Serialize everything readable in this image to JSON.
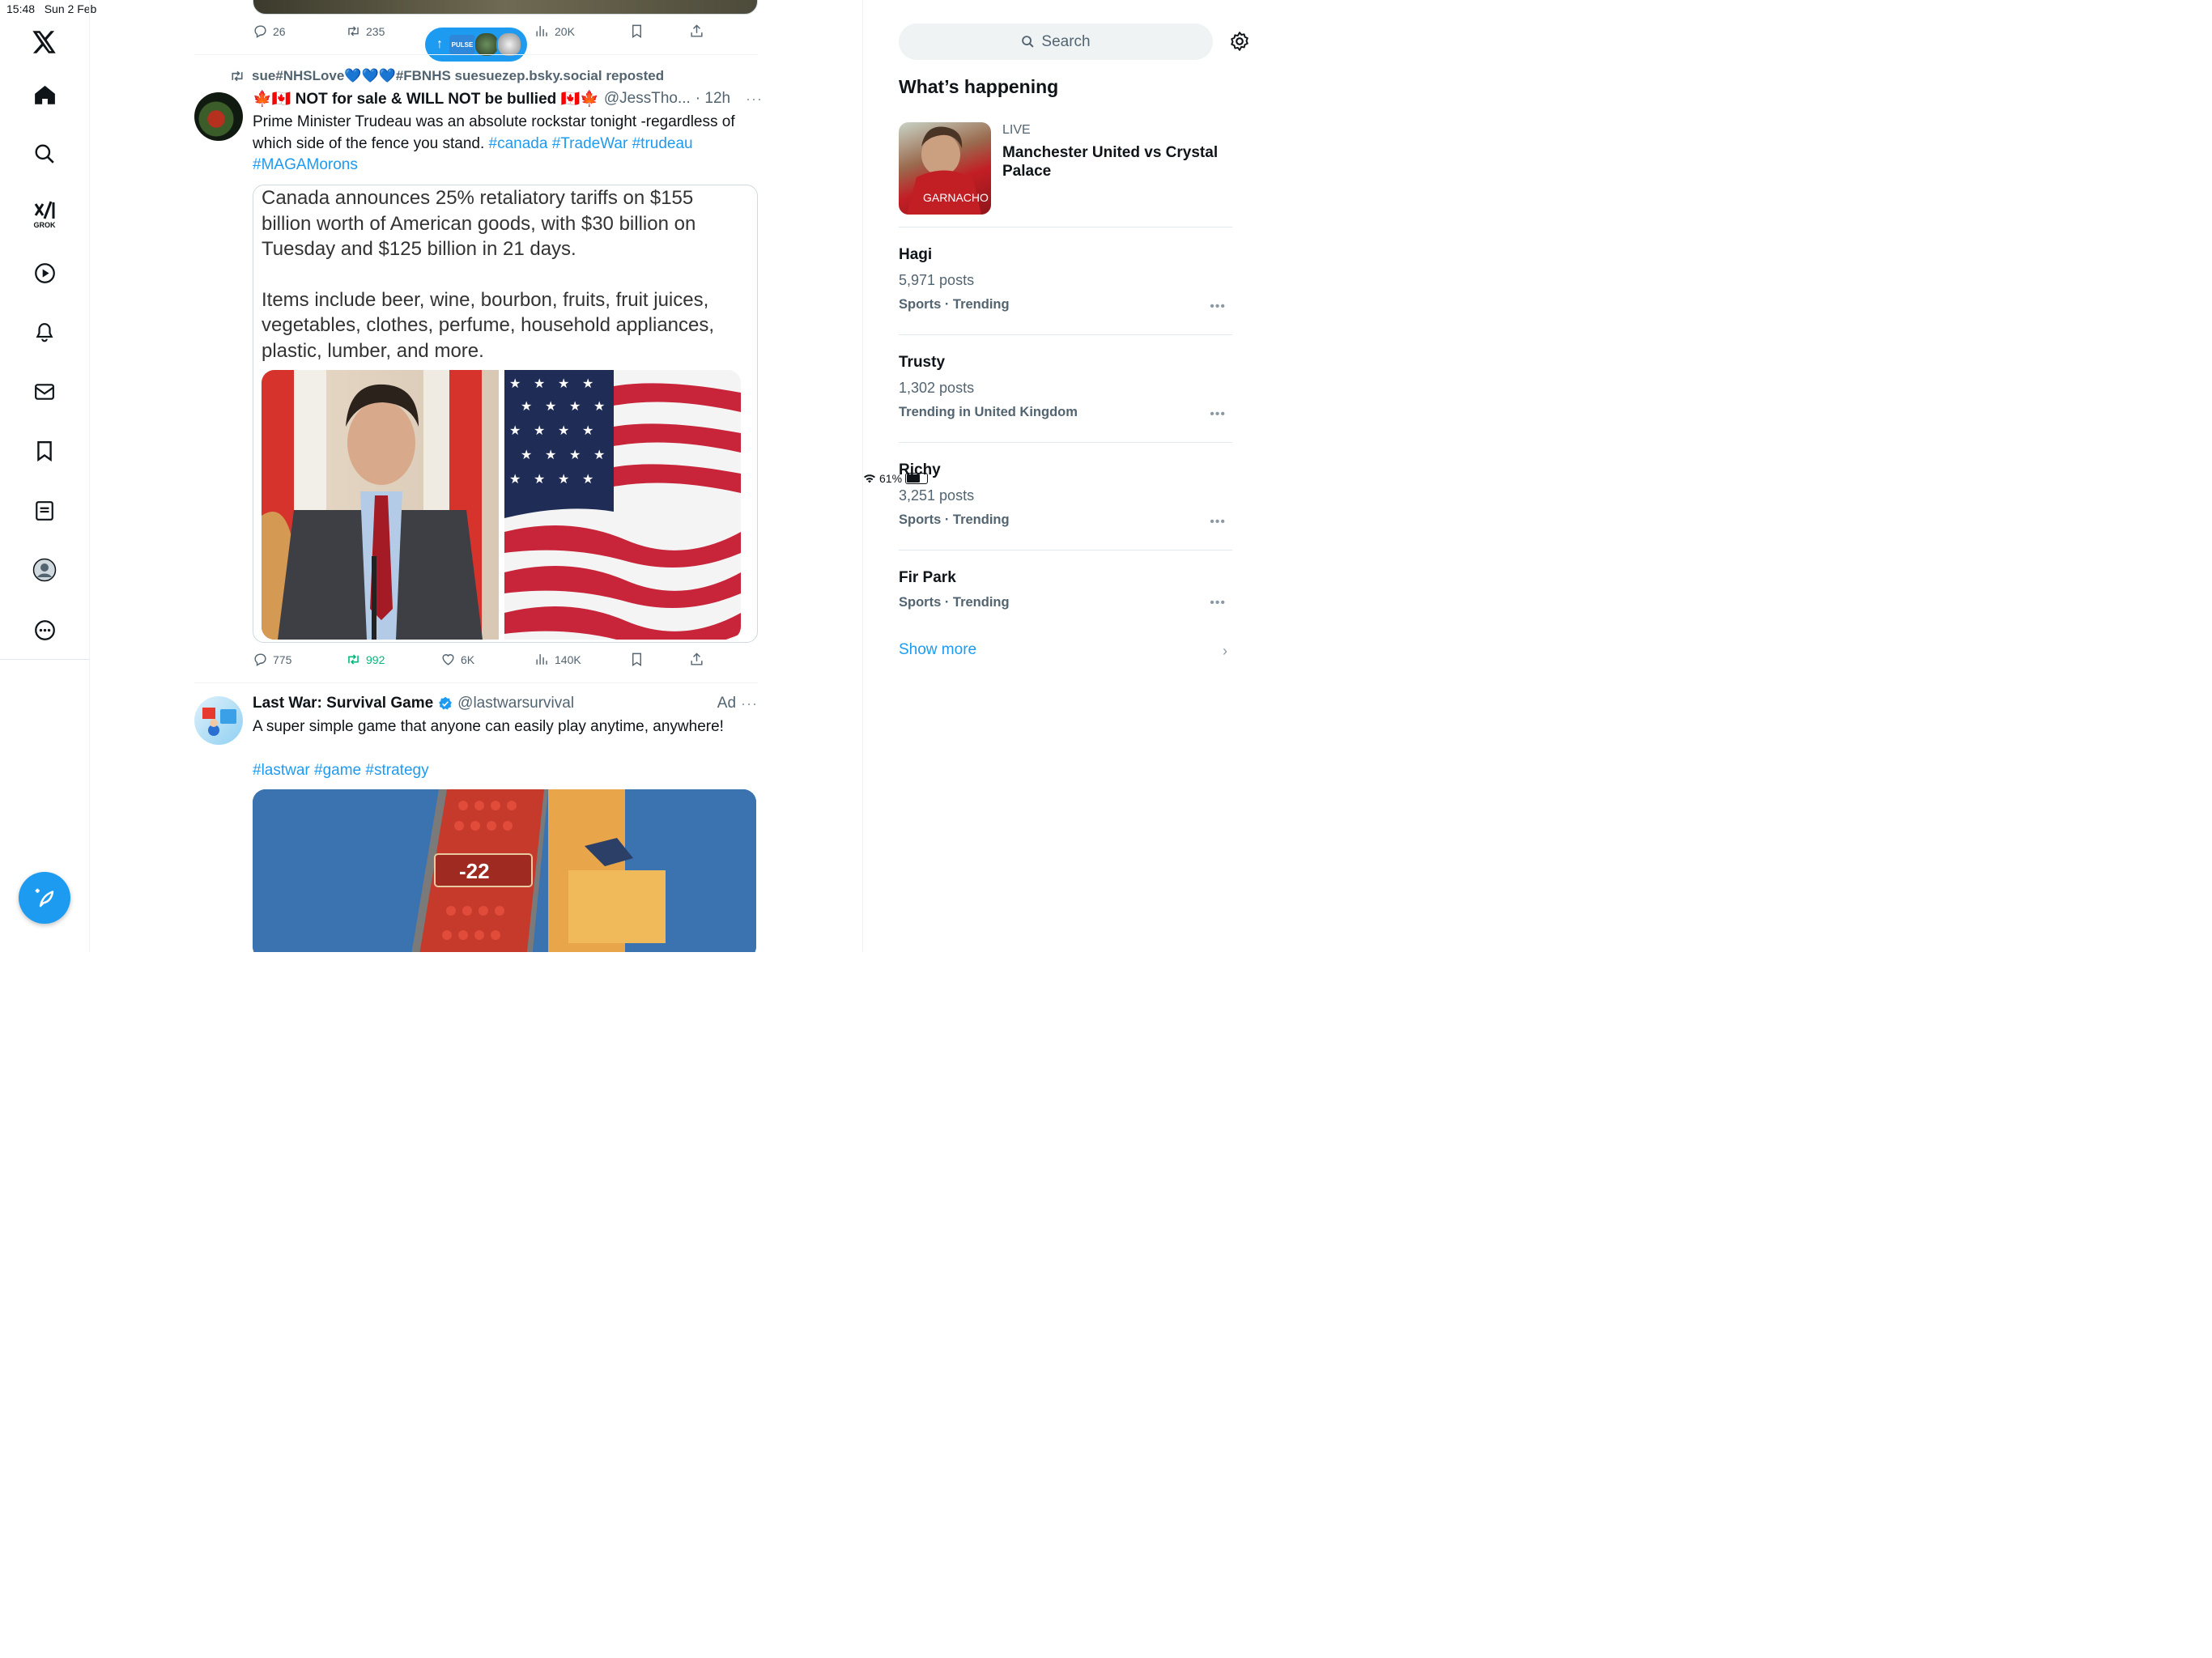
{
  "status": {
    "time": "15:48",
    "date": "Sun 2 Feb",
    "battery": "61%"
  },
  "nav": {
    "items": [
      {
        "icon": "x-logo-icon"
      },
      {
        "icon": "home-icon"
      },
      {
        "icon": "search-icon"
      },
      {
        "icon": "grok-icon",
        "label": "GROK"
      },
      {
        "icon": "video-icon"
      },
      {
        "icon": "bell-icon"
      },
      {
        "icon": "mail-icon"
      },
      {
        "icon": "bookmark-icon"
      },
      {
        "icon": "lists-icon"
      },
      {
        "icon": "profile-icon"
      },
      {
        "icon": "more-icon"
      }
    ],
    "grok_label": "GROK",
    "compose_icon": "compose-icon"
  },
  "feed": {
    "prev_tweet_actions": {
      "replies": "26",
      "reposts": "235",
      "views": "20K"
    },
    "pulse": {
      "label": "PULSE"
    },
    "tweet": {
      "repost_by": "sue#NHSLove💙💙💙#FBNHS suesuezep.bsky.social reposted",
      "name": "🍁🇨🇦 NOT for sale & WILL NOT be bullied 🇨🇦🍁",
      "handle": "@JessTho...",
      "time": "· 12h",
      "text": "Prime Minister Trudeau was an absolute rockstar tonight -regardless of which side of the fence you stand.",
      "tags": [
        "#canada",
        "#TradeWar",
        "#trudeau",
        "#MAGAMorons"
      ],
      "card_text_1": "Canada announces 25% retaliatory tariffs on $155 billion worth of American goods, with $30 billion on Tuesday and $125 billion in 21 days.",
      "card_text_2": "Items include beer, wine, bourbon, fruits, fruit juices, vegetables, clothes, perfume, household appliances, plastic, lumber, and more.",
      "replies": "775",
      "reposts": "992",
      "likes": "6K",
      "views": "140K"
    },
    "ad": {
      "name": "Last War: Survival Game",
      "handle": "@lastwarsurvival",
      "ad_label": "Ad",
      "text": "A super simple game that anyone can easily play anytime, anywhere!",
      "tags": [
        "#lastwar",
        "#game",
        "#strategy"
      ],
      "video_counter": "-22"
    }
  },
  "sidebar": {
    "search_placeholder": "Search",
    "title": "What’s happening",
    "live": {
      "label": "LIVE",
      "title": "Manchester United vs Crystal Palace",
      "image_caption": "GARNACHO"
    },
    "trends": [
      {
        "name": "Hagi",
        "count": "5,971 posts",
        "category": "Sports · Trending"
      },
      {
        "name": "Trusty",
        "count": "1,302 posts",
        "category": "Trending in United Kingdom"
      },
      {
        "name": "Richy",
        "count": "3,251 posts",
        "category": "Sports · Trending"
      },
      {
        "name": "Fir Park",
        "count": "",
        "category": "Sports · Trending"
      }
    ],
    "show_more": "Show more"
  },
  "colors": {
    "accent": "#1d9bf0",
    "repost_green": "#00ba7c",
    "text": "#0f1419",
    "muted": "#536471"
  }
}
